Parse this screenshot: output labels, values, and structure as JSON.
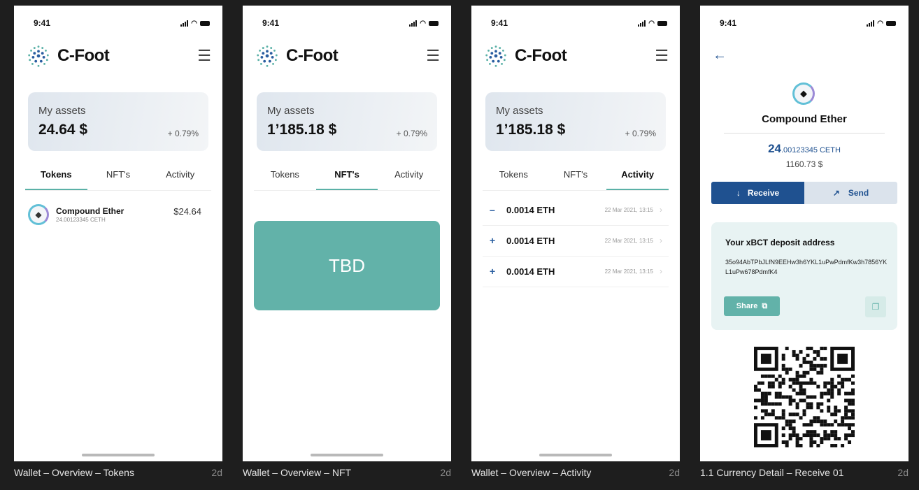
{
  "screens": [
    {
      "caption": "Wallet – Overview – Tokens",
      "age": "2d",
      "time": "9:41",
      "brand": "C-Foot",
      "assets_label": "My assets",
      "assets_value": "24.64 $",
      "assets_change": "+ 0.79%",
      "tabs": [
        "Tokens",
        "NFT's",
        "Activity"
      ],
      "token": {
        "name": "Compound Ether",
        "sub": "24.00123345 CETH",
        "amount": "$24.64"
      }
    },
    {
      "caption": "Wallet – Overview – NFT",
      "age": "2d",
      "time": "9:41",
      "brand": "C-Foot",
      "assets_label": "My assets",
      "assets_value": "1’185.18 $",
      "assets_change": "+ 0.79%",
      "tabs": [
        "Tokens",
        "NFT's",
        "Activity"
      ],
      "placeholder": "TBD"
    },
    {
      "caption": "Wallet – Overview – Activity",
      "age": "2d",
      "time": "9:41",
      "brand": "C-Foot",
      "assets_label": "My assets",
      "assets_value": "1’185.18 $",
      "assets_change": "+ 0.79%",
      "tabs": [
        "Tokens",
        "NFT's",
        "Activity"
      ],
      "activity": [
        {
          "sign": "–",
          "amount": "0.0014 ETH",
          "date": "22 Mar 2021, 13:15"
        },
        {
          "sign": "+",
          "amount": "0.0014 ETH",
          "date": "22 Mar 2021, 13:15"
        },
        {
          "sign": "+",
          "amount": "0.0014 ETH",
          "date": "22 Mar 2021, 13:15"
        }
      ]
    },
    {
      "caption": "1.1 Currency Detail – Receive 01",
      "age": "2d",
      "time": "9:41",
      "coin_name": "Compound Ether",
      "amount_int": "24",
      "amount_frac": ".00123345",
      "amount_unit": "CETH",
      "amount_usd": "1160.73 $",
      "receive_label": "Receive",
      "send_label": "Send",
      "deposit_title": "Your xBCT deposit address",
      "deposit_address": "35o94AbTPbJLfN9EEHw3h6YKL1uPwPdmfKw3h7856YKL1uPw678PdmfK4",
      "share_label": "Share"
    }
  ],
  "icons": {
    "menu": "hamburger-icon",
    "back": "arrow-left-icon",
    "receive": "arrow-down-icon",
    "send": "arrow-up-right-icon",
    "share": "external-link-icon",
    "copy": "copy-icon"
  },
  "colors": {
    "accent_teal": "#62b2a9",
    "primary_blue": "#1f5190",
    "background": "#1e1e1e"
  }
}
